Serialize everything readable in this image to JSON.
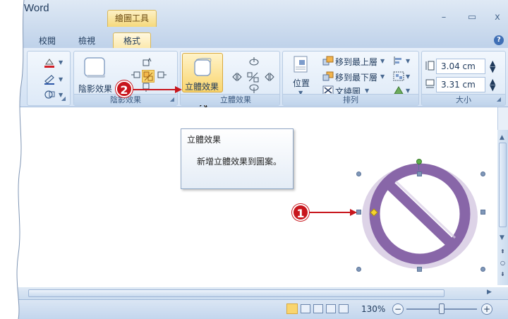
{
  "window": {
    "app_title": "Word",
    "contextual_tab": "繪圖工具",
    "minimize_glyph": "–",
    "restore_glyph": "▭",
    "close_glyph": "x",
    "help_glyph": "?"
  },
  "tabs": {
    "review": "校閱",
    "view": "檢視",
    "format": "格式"
  },
  "ribbon": {
    "shadow_group": {
      "button_label": "陰影效果",
      "group_label": "陰影效果"
    },
    "threed_group": {
      "button_label": "立體效果",
      "group_label": "立體效果"
    },
    "arrange_group": {
      "bring_to_front": "移到最上層",
      "send_to_back": "移到最下層",
      "text_wrapping": "文繞圖",
      "position": "位置",
      "group_label": "排列"
    },
    "size_group": {
      "height_value": "3.04 cm",
      "width_value": "3.31 cm",
      "group_label": "大小"
    }
  },
  "tooltip": {
    "title": "立體效果",
    "description": "新增立體效果到圖案。"
  },
  "callouts": {
    "one": "1",
    "two": "2"
  },
  "statusbar": {
    "zoom_level": "130%",
    "zoom_out": "−",
    "zoom_in": "+"
  },
  "colors": {
    "shape_fill": "#8866a8",
    "callout_red": "#c8161d",
    "ribbon_selected": "#f9d56e"
  }
}
